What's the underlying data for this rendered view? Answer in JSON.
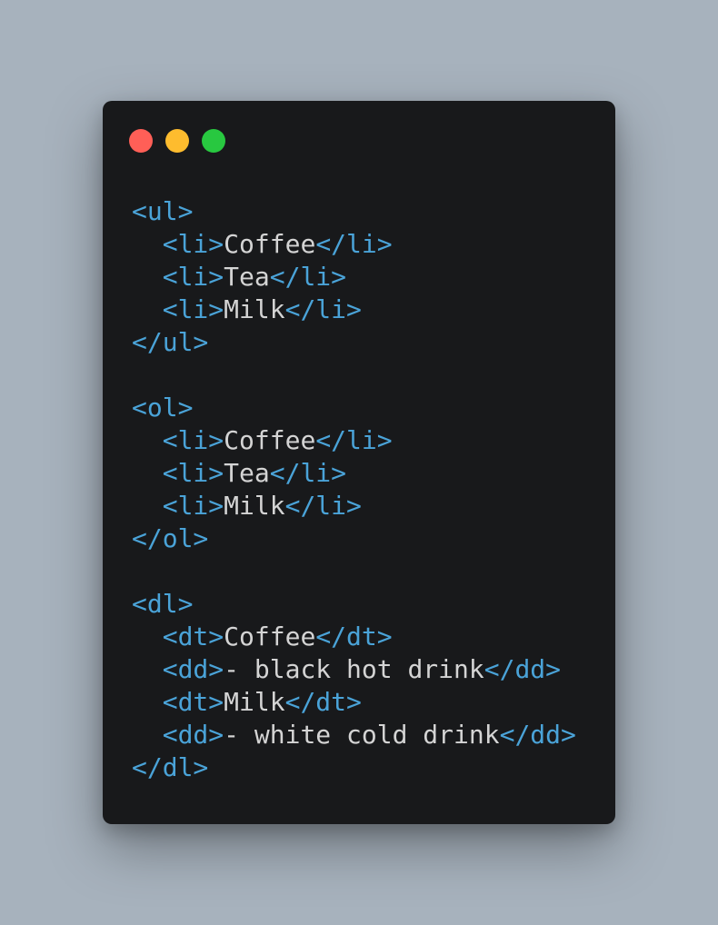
{
  "colors": {
    "background": "#a7b2bd",
    "window": "#18191b",
    "tag": "#4aa3d8",
    "text": "#d4d4d4",
    "dot_close": "#ff5f57",
    "dot_minimize": "#febc2e",
    "dot_maximize": "#28c840"
  },
  "window_controls": [
    {
      "name": "close-dot",
      "color": "#ff5f57"
    },
    {
      "name": "minimize-dot",
      "color": "#febc2e"
    },
    {
      "name": "maximize-dot",
      "color": "#28c840"
    }
  ],
  "code": {
    "language": "html",
    "lines": [
      [
        {
          "t": "tag",
          "v": "<ul>"
        }
      ],
      [
        {
          "t": "text",
          "v": "  "
        },
        {
          "t": "tag",
          "v": "<li>"
        },
        {
          "t": "text",
          "v": "Coffee"
        },
        {
          "t": "tag",
          "v": "</li>"
        }
      ],
      [
        {
          "t": "text",
          "v": "  "
        },
        {
          "t": "tag",
          "v": "<li>"
        },
        {
          "t": "text",
          "v": "Tea"
        },
        {
          "t": "tag",
          "v": "</li>"
        }
      ],
      [
        {
          "t": "text",
          "v": "  "
        },
        {
          "t": "tag",
          "v": "<li>"
        },
        {
          "t": "text",
          "v": "Milk"
        },
        {
          "t": "tag",
          "v": "</li>"
        }
      ],
      [
        {
          "t": "tag",
          "v": "</ul>"
        }
      ],
      [],
      [
        {
          "t": "tag",
          "v": "<ol>"
        }
      ],
      [
        {
          "t": "text",
          "v": "  "
        },
        {
          "t": "tag",
          "v": "<li>"
        },
        {
          "t": "text",
          "v": "Coffee"
        },
        {
          "t": "tag",
          "v": "</li>"
        }
      ],
      [
        {
          "t": "text",
          "v": "  "
        },
        {
          "t": "tag",
          "v": "<li>"
        },
        {
          "t": "text",
          "v": "Tea"
        },
        {
          "t": "tag",
          "v": "</li>"
        }
      ],
      [
        {
          "t": "text",
          "v": "  "
        },
        {
          "t": "tag",
          "v": "<li>"
        },
        {
          "t": "text",
          "v": "Milk"
        },
        {
          "t": "tag",
          "v": "</li>"
        }
      ],
      [
        {
          "t": "tag",
          "v": "</ol>"
        }
      ],
      [],
      [
        {
          "t": "tag",
          "v": "<dl>"
        }
      ],
      [
        {
          "t": "text",
          "v": "  "
        },
        {
          "t": "tag",
          "v": "<dt>"
        },
        {
          "t": "text",
          "v": "Coffee"
        },
        {
          "t": "tag",
          "v": "</dt>"
        }
      ],
      [
        {
          "t": "text",
          "v": "  "
        },
        {
          "t": "tag",
          "v": "<dd>"
        },
        {
          "t": "text",
          "v": "- black hot drink"
        },
        {
          "t": "tag",
          "v": "</dd>"
        }
      ],
      [
        {
          "t": "text",
          "v": "  "
        },
        {
          "t": "tag",
          "v": "<dt>"
        },
        {
          "t": "text",
          "v": "Milk"
        },
        {
          "t": "tag",
          "v": "</dt>"
        }
      ],
      [
        {
          "t": "text",
          "v": "  "
        },
        {
          "t": "tag",
          "v": "<dd>"
        },
        {
          "t": "text",
          "v": "- white cold drink"
        },
        {
          "t": "tag",
          "v": "</dd>"
        }
      ],
      [
        {
          "t": "tag",
          "v": "</dl>"
        }
      ]
    ]
  }
}
